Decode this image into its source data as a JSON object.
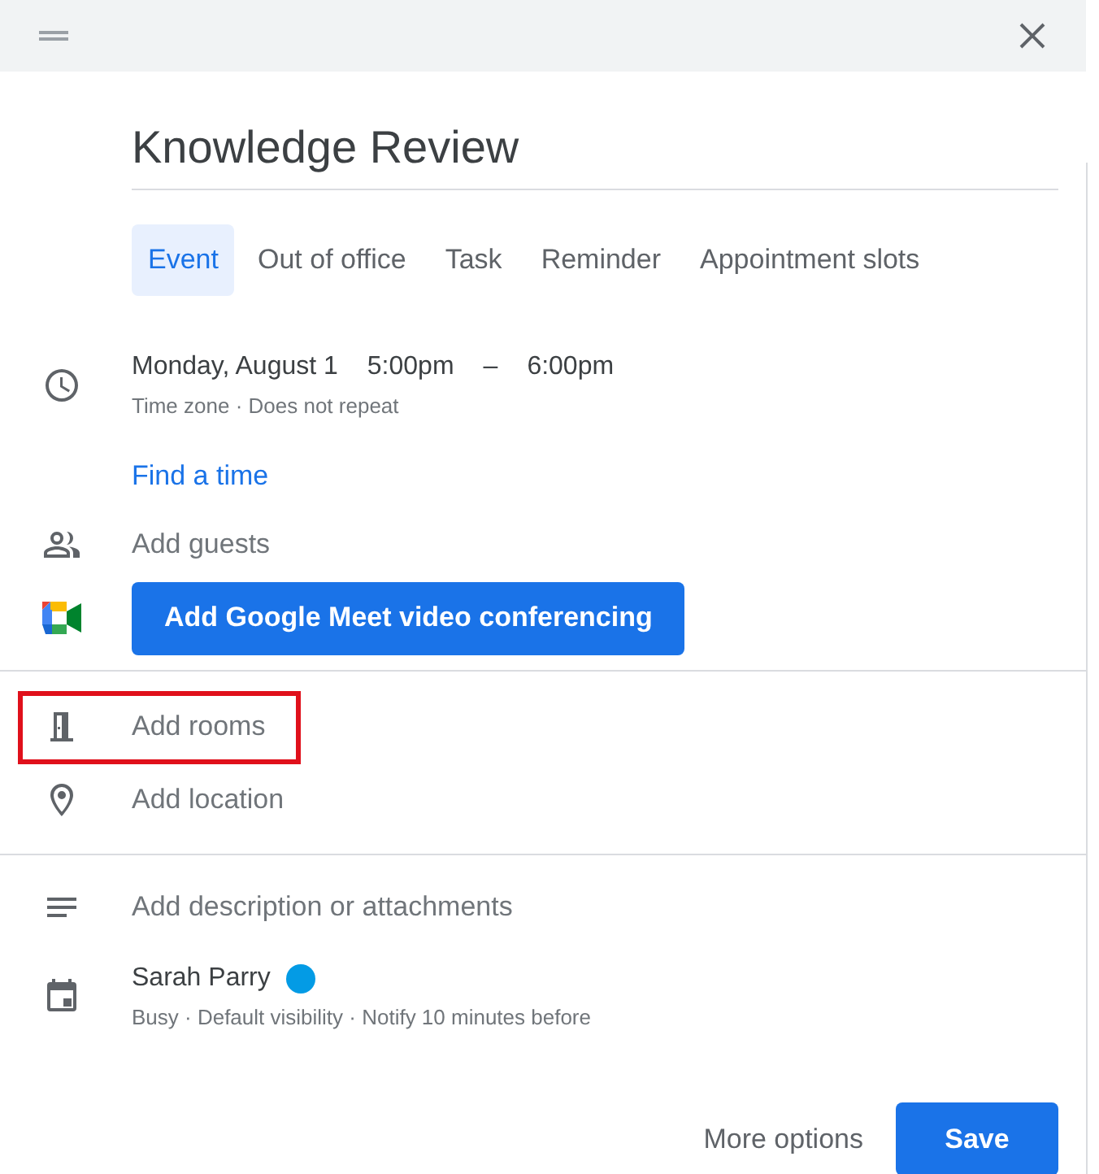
{
  "title": "Knowledge Review",
  "tabs": [
    {
      "label": "Event",
      "selected": true
    },
    {
      "label": "Out of office",
      "selected": false
    },
    {
      "label": "Task",
      "selected": false
    },
    {
      "label": "Reminder",
      "selected": false
    },
    {
      "label": "Appointment slots",
      "selected": false
    }
  ],
  "when": {
    "date": "Monday, August 1",
    "start": "5:00pm",
    "dash": "–",
    "end": "6:00pm",
    "details": "Time zone · Does not repeat",
    "link": "Find a time"
  },
  "guests": {
    "placeholder": "Add guests"
  },
  "meet_button": "Add Google Meet video conferencing",
  "rooms": {
    "label": "Add rooms",
    "highlighted": true
  },
  "location": {
    "placeholder": "Add location"
  },
  "description": {
    "placeholder": "Add description or attachments"
  },
  "calendar": {
    "name": "Sarah Parry",
    "color": "#039be5",
    "details": "Busy · Default visibility · Notify 10 minutes before"
  },
  "footer": {
    "more": "More options",
    "save": "Save"
  }
}
